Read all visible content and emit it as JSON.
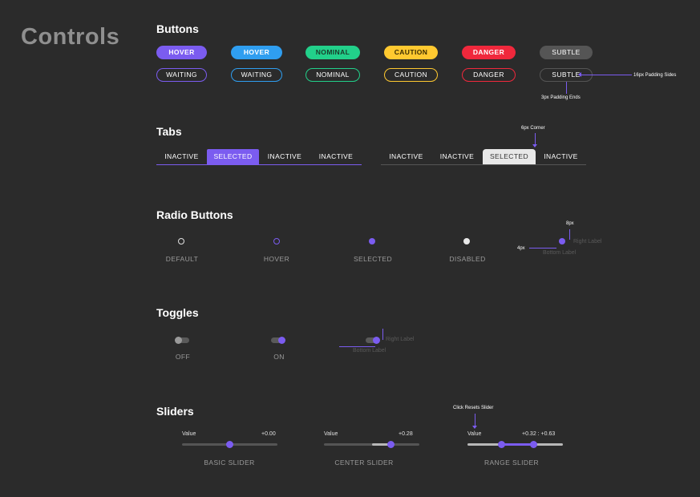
{
  "page_title": "Controls",
  "sections": {
    "buttons": "Buttons",
    "tabs": "Tabs",
    "radio_buttons": "Radio Buttons",
    "toggles": "Toggles",
    "sliders": "Sliders"
  },
  "buttons": {
    "filled": [
      "HOVER",
      "HOVER",
      "NOMINAL",
      "CAUTION",
      "DANGER",
      "SUBTLE"
    ],
    "outline": [
      "WAITING",
      "WAITING",
      "NOMINAL",
      "CAUTION",
      "DANGER",
      "SUBTLE"
    ],
    "colors": [
      "#7b5cf0",
      "#2f9ef0",
      "#22d08a",
      "#ffc930",
      "#f0283c",
      "#555555"
    ]
  },
  "tabs": {
    "left": [
      "INACTIVE",
      "SELECTED",
      "INACTIVE",
      "INACTIVE"
    ],
    "right": [
      "INACTIVE",
      "INACTIVE",
      "SELECTED",
      "INACTIVE"
    ]
  },
  "radios": {
    "labels": [
      "DEFAULT",
      "HOVER",
      "SELECTED",
      "DISABLED"
    ],
    "right_label": "Right Label",
    "bottom_label": "Bottom Label"
  },
  "toggles": {
    "labels": [
      "OFF",
      "ON"
    ],
    "right_label": "Right Label",
    "bottom_label": "Bottom Label"
  },
  "sliders": {
    "value_label": "Value",
    "items": [
      {
        "label": "BASIC SLIDER",
        "value": "+0.00",
        "position": 0.5
      },
      {
        "label": "CENTER SLIDER",
        "value": "+0.28",
        "position": 0.7,
        "fill_from": 0.5
      },
      {
        "label": "RANGE SLIDER",
        "value": "+0.32 : +0.63",
        "range": [
          0.36,
          0.69
        ]
      }
    ]
  },
  "annotations": {
    "padding_sides": "16px Padding Sides",
    "padding_ends": "3px Padding Ends",
    "corner": "6px Corner",
    "radio_8px": "8px",
    "radio_4px": "4px",
    "click_resets": "Click Resets Slider"
  },
  "colors": {
    "accent": "#7b5cf0",
    "background": "#2b2b2b",
    "disabled": "#e8e8e8"
  }
}
